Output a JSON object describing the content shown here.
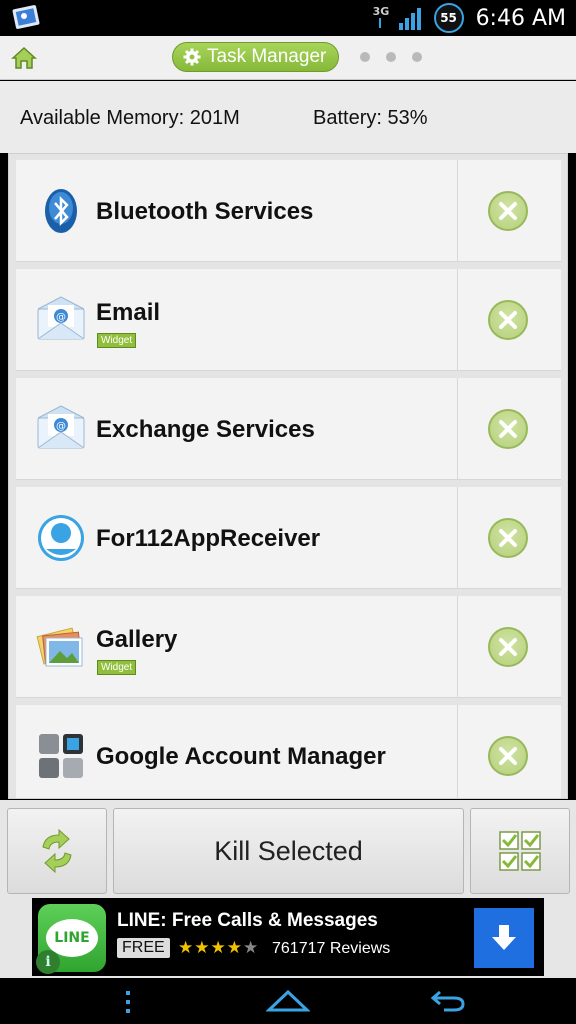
{
  "status_bar": {
    "network": "3G",
    "battery_level": "55",
    "time": "6:46 AM"
  },
  "header": {
    "title": "Task Manager",
    "page_dots": 3
  },
  "info": {
    "memory": "Available Memory: 201M",
    "battery": "Battery: 53%"
  },
  "tasks": [
    {
      "name": "Bluetooth Services",
      "icon": "bluetooth-icon",
      "widget": ""
    },
    {
      "name": "Email",
      "icon": "email-icon",
      "widget": "Widget"
    },
    {
      "name": "Exchange Services",
      "icon": "email-icon",
      "widget": ""
    },
    {
      "name": "For112AppReceiver",
      "icon": "person-icon",
      "widget": ""
    },
    {
      "name": "Gallery",
      "icon": "gallery-icon",
      "widget": "Widget"
    },
    {
      "name": "Google Account Manager",
      "icon": "account-manager-icon",
      "widget": ""
    }
  ],
  "toolbar": {
    "kill_label": "Kill Selected"
  },
  "ad": {
    "logo_text": "LINE",
    "title": "LINE: Free Calls & Messages",
    "price": "FREE",
    "stars_filled": "★★★★",
    "stars_empty": "★",
    "reviews": "761717 Reviews"
  },
  "colors": {
    "accent_green": "#86b93a",
    "kill_button": "#b6d07c",
    "download_blue": "#1f6fe0"
  }
}
